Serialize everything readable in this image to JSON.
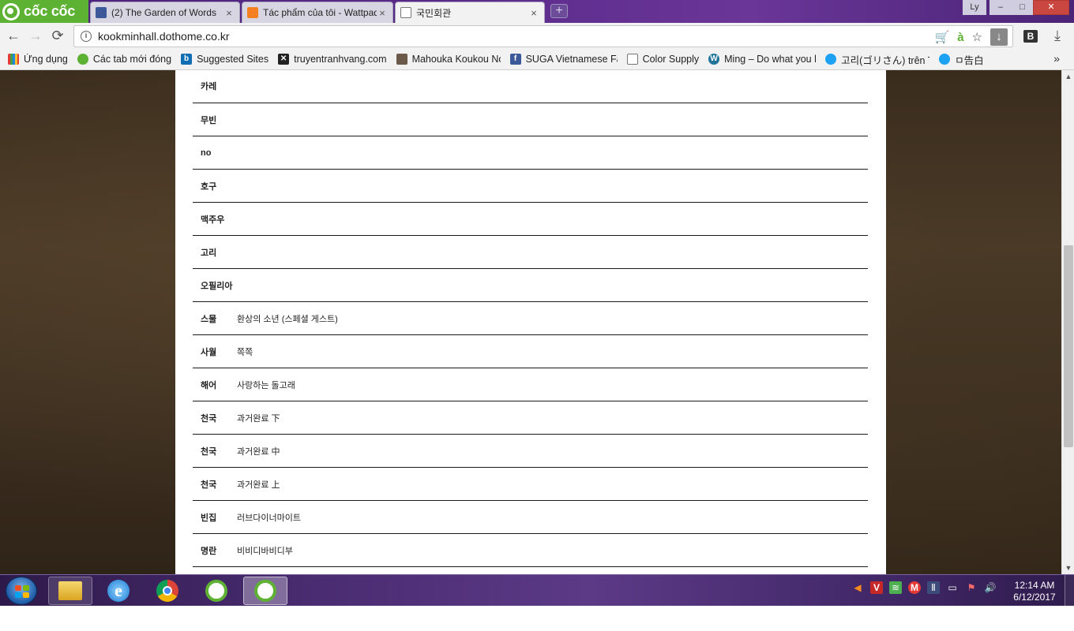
{
  "browser": {
    "brand": "cốc cốc",
    "tabs": [
      {
        "label": "(2) The Garden of Words",
        "close": "×",
        "favicon": "facebook-icon"
      },
      {
        "label": "Tác phẩm của tôi - Wattpad",
        "close": "×",
        "favicon": "wattpad-icon"
      },
      {
        "label": "국민회관",
        "close": "×",
        "favicon": "page-icon",
        "active": true
      }
    ],
    "new_tab": "+",
    "profile": "Ly",
    "window_controls": {
      "minimize": "–",
      "maximize": "□",
      "close": "✕"
    }
  },
  "address": {
    "url": "kookminhall.dothome.co.kr",
    "back": "←",
    "forward": "→",
    "reload": "⟳"
  },
  "bookmarks": [
    {
      "label": "Ứng dụng",
      "icon": "apps-grid-icon"
    },
    {
      "label": "Các tab mới đóng",
      "icon": "recent-tabs-icon"
    },
    {
      "label": "Suggested Sites",
      "icon": "bing-icon"
    },
    {
      "label": "truyentranhvang.com",
      "icon": "site-icon"
    },
    {
      "label": "Mahouka Koukou No",
      "icon": "anime-icon"
    },
    {
      "label": "SUGA Vietnamese Far",
      "icon": "facebook-icon"
    },
    {
      "label": "Color Supply",
      "icon": "page-icon"
    },
    {
      "label": "Ming – Do what you k",
      "icon": "wordpress-icon"
    },
    {
      "label": "고리(ゴリさん) trên Tv",
      "icon": "twitter-icon"
    },
    {
      "label": "ㅁ告白",
      "icon": "twitter-icon"
    }
  ],
  "bookmarks_more": "»",
  "rows": [
    {
      "name": "카레",
      "title": ""
    },
    {
      "name": "무빈",
      "title": ""
    },
    {
      "name": "no",
      "title": ""
    },
    {
      "name": "호구",
      "title": ""
    },
    {
      "name": "맥주우",
      "title": ""
    },
    {
      "name": "고리",
      "title": ""
    },
    {
      "name": "오필리아",
      "title": ""
    },
    {
      "name": "스물",
      "title": "환상의 소년 (스페셜 게스트)"
    },
    {
      "name": "사월",
      "title": "쪽쪽"
    },
    {
      "name": "해어",
      "title": "사랑하는 돌고래"
    },
    {
      "name": "천국",
      "title": "과거완료 下"
    },
    {
      "name": "천국",
      "title": "과거완료 中"
    },
    {
      "name": "천국",
      "title": "과거완료 上"
    },
    {
      "name": "빈집",
      "title": "러브다이너마이트"
    },
    {
      "name": "명란",
      "title": "비비디바비디부"
    }
  ],
  "taskbar": {
    "apps": [
      {
        "name": "file-explorer-icon"
      },
      {
        "name": "internet-explorer-icon"
      },
      {
        "name": "chrome-icon"
      },
      {
        "name": "coccoc-icon"
      },
      {
        "name": "coccoc-icon-active"
      }
    ],
    "clock_time": "12:14 AM",
    "clock_date": "6/12/2017"
  },
  "colors": {
    "tab_strip": "#5a2a8a",
    "brand_green": "#5eb233",
    "page_bg": "#3a2c1d",
    "taskbar": "#4a2c72"
  }
}
